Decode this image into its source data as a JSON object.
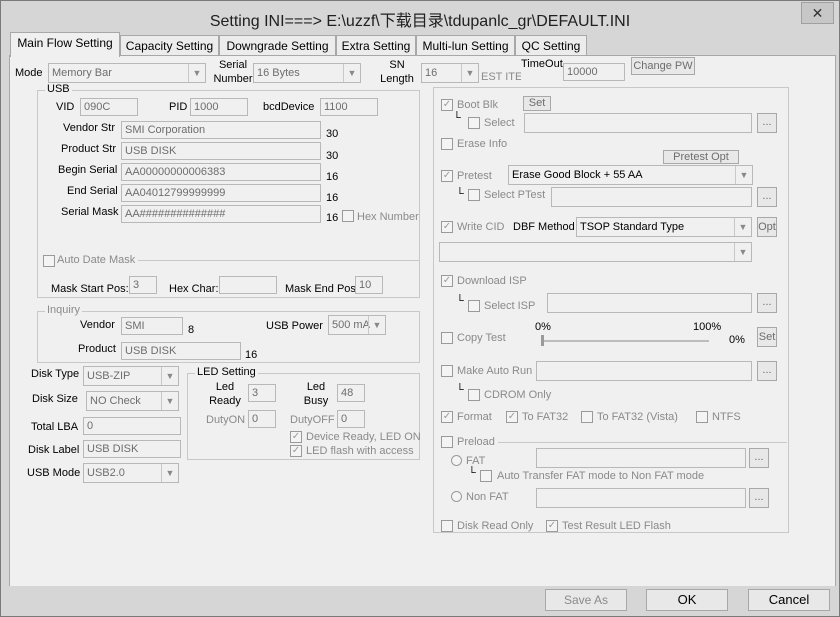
{
  "window": {
    "title": "Setting  INI===> E:\\uzzf\\下载目录\\tdupanlc_gr\\DEFAULT.INI",
    "close": "✕"
  },
  "tabs": [
    "Main Flow Setting",
    "Capacity Setting",
    "Downgrade Setting",
    "Extra Setting",
    "Multi-lun Setting",
    "QC Setting"
  ],
  "top": {
    "mode_label": "Mode",
    "mode_value": "Memory Bar",
    "serial_number_label": "Serial Number",
    "serial_number_value": "16 Bytes",
    "sn_length_label": "SN Length",
    "sn_length_value": "16",
    "sn_length_trailing": "EST ITEM",
    "timeout_label": "TimeOut",
    "timeout_value": "10000",
    "change_pw": "Change PW"
  },
  "usb": {
    "title": "USB",
    "vid_label": "VID",
    "vid": "090C",
    "pid_label": "PID",
    "pid": "1000",
    "bcd_label": "bcdDevice",
    "bcd": "1100",
    "vendor_str_label": "Vendor Str",
    "vendor_str": "SMI Corporation",
    "vendor_str_len": "30",
    "product_str_label": "Product Str",
    "product_str": "USB DISK",
    "product_str_len": "30",
    "begin_serial_label": "Begin Serial",
    "begin_serial": "AA00000000006383",
    "begin_serial_len": "16",
    "end_serial_label": "End Serial",
    "end_serial": "AA04012799999999",
    "end_serial_len": "16",
    "serial_mask_label": "Serial Mask",
    "serial_mask": "AA##############",
    "serial_mask_len": "16",
    "hex_number": "Hex Number",
    "auto_date_mask": "Auto Date Mask",
    "mask_start_label": "Mask Start Pos:",
    "mask_start": "3",
    "hex_char_label": "Hex Char:",
    "hex_char": "",
    "mask_end_label": "Mask End Pos:",
    "mask_end": "10"
  },
  "inquiry": {
    "title": "Inquiry",
    "vendor_label": "Vendor",
    "vendor": "SMI",
    "vendor_len": "8",
    "product_label": "Product",
    "product": "USB DISK",
    "product_len": "16",
    "usb_power_label": "USB Power",
    "usb_power": "500 mA"
  },
  "disk": {
    "disk_type_label": "Disk Type",
    "disk_type": "USB-ZIP",
    "disk_size_label": "Disk Size",
    "disk_size": "NO Check",
    "total_lba_label": "Total LBA",
    "total_lba": "0",
    "disk_label_label": "Disk Label",
    "disk_label": "USB DISK",
    "usb_mode_label": "USB Mode",
    "usb_mode": "USB2.0"
  },
  "led": {
    "title": "LED Setting",
    "ready_label": "Led Ready",
    "ready": "3",
    "busy_label": "Led Busy",
    "busy": "48",
    "dutyon_label": "DutyON",
    "dutyon": "0",
    "dutyoff_label": "DutyOFF",
    "dutyoff": "0",
    "device_ready": "Device Ready, LED ON",
    "flash_access": "LED flash with access"
  },
  "right": {
    "boot_blk": "Boot Blk",
    "set": "Set",
    "select": "Select",
    "more": "...",
    "erase_info": "Erase Info",
    "pretest_opt": "Pretest Opt",
    "pretest": "Pretest",
    "pretest_value": "Erase Good Block + 55 AA",
    "select_ptest": "Select PTest",
    "write_cid": "Write CID",
    "dbf_method_label": "DBF Method",
    "dbf_method": "TSOP Standard Type",
    "opt": "Opt",
    "download_isp": "Download ISP",
    "select_isp": "Select ISP",
    "copy_test": "Copy Test",
    "pct_0": "0%",
    "pct_100": "100%",
    "copy_pct": "0%",
    "make_auto_run": "Make Auto Run",
    "cdrom_only": "CDROM Only",
    "format": "Format",
    "to_fat32": "To FAT32",
    "to_fat32_vista": "To FAT32 (Vista)",
    "ntfs": "NTFS",
    "preload": "Preload",
    "fat": "FAT",
    "auto_transfer": "Auto Transfer FAT mode to Non FAT mode",
    "non_fat": "Non FAT",
    "disk_read_only": "Disk Read Only",
    "test_result_led": "Test Result LED Flash"
  },
  "footer": {
    "save_as": "Save  As",
    "ok": "OK",
    "cancel": "Cancel"
  },
  "glyphs": {
    "check": "✓",
    "arrow_down": "▼",
    "ell": "└"
  }
}
